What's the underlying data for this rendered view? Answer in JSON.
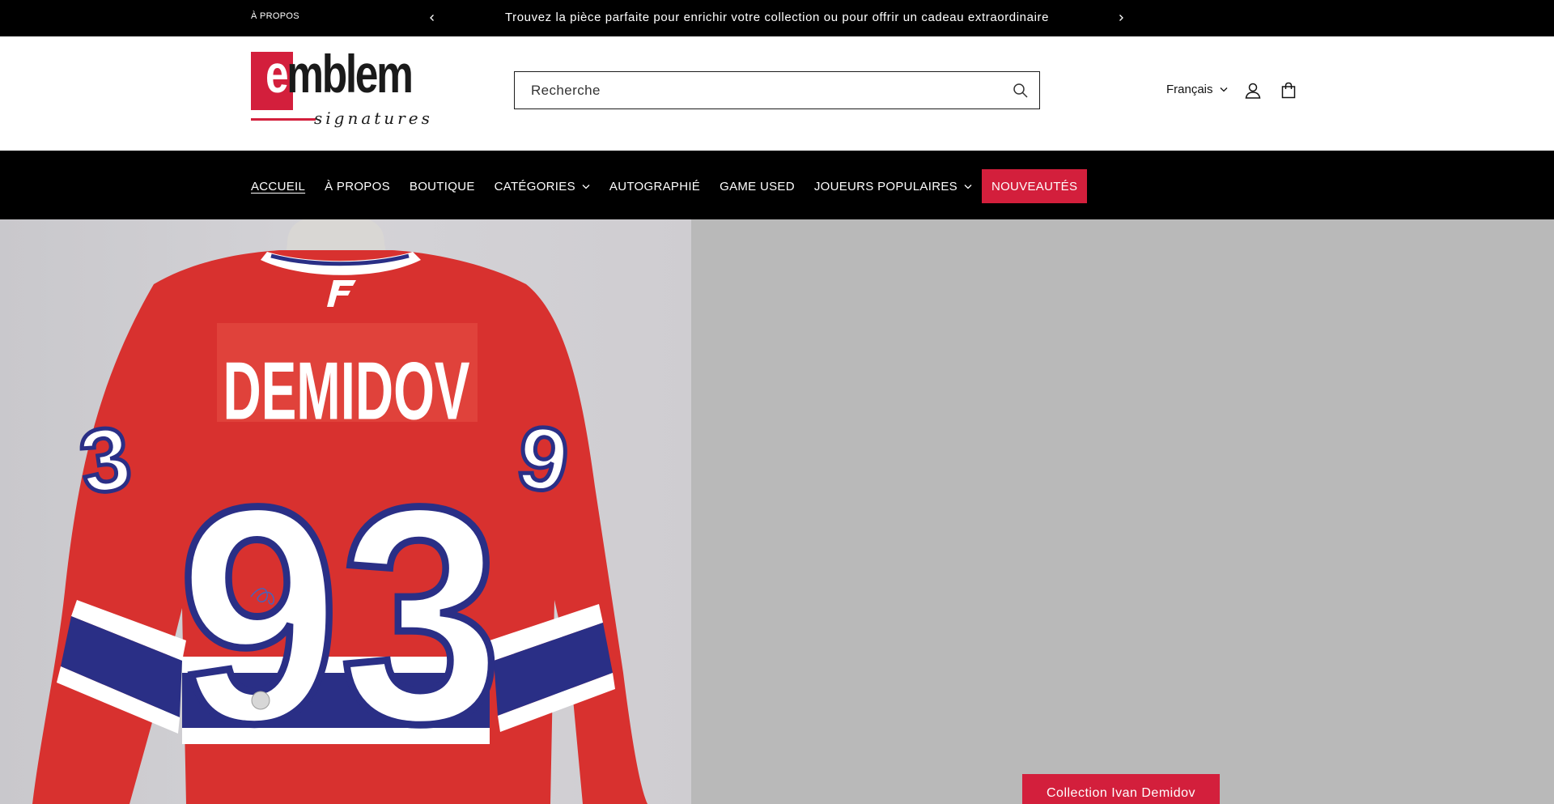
{
  "announcement": {
    "about_link": "À PROPOS",
    "message": "Trouvez la pièce parfaite pour enrichir votre collection ou pour offrir un cadeau extraordinaire"
  },
  "header": {
    "logo": {
      "word": "emblem",
      "tagline": "signatures"
    },
    "search": {
      "placeholder": "Recherche"
    },
    "language": "Français"
  },
  "nav": {
    "items": [
      {
        "label": "ACCUEIL"
      },
      {
        "label": "À PROPOS"
      },
      {
        "label": "BOUTIQUE"
      },
      {
        "label": "CATÉGORIES"
      },
      {
        "label": "AUTOGRAPHIÉ"
      },
      {
        "label": "GAME USED"
      },
      {
        "label": "JOUEURS POPULAIRES"
      },
      {
        "label": "NOUVEAUTÉS"
      }
    ]
  },
  "hero": {
    "jersey_name": "DEMIDOV",
    "jersey_number": "93",
    "cta_label": "Collection Ivan Demidov"
  },
  "colors": {
    "brand_red": "#d31f3c",
    "black": "#000000",
    "hero_gray": "#b9b9b9",
    "jersey_red": "#d8312f",
    "jersey_blue": "#2a2f86"
  },
  "icons": [
    "chevron-left-icon",
    "chevron-right-icon",
    "search-icon",
    "chevron-down-icon",
    "account-icon",
    "cart-icon"
  ]
}
